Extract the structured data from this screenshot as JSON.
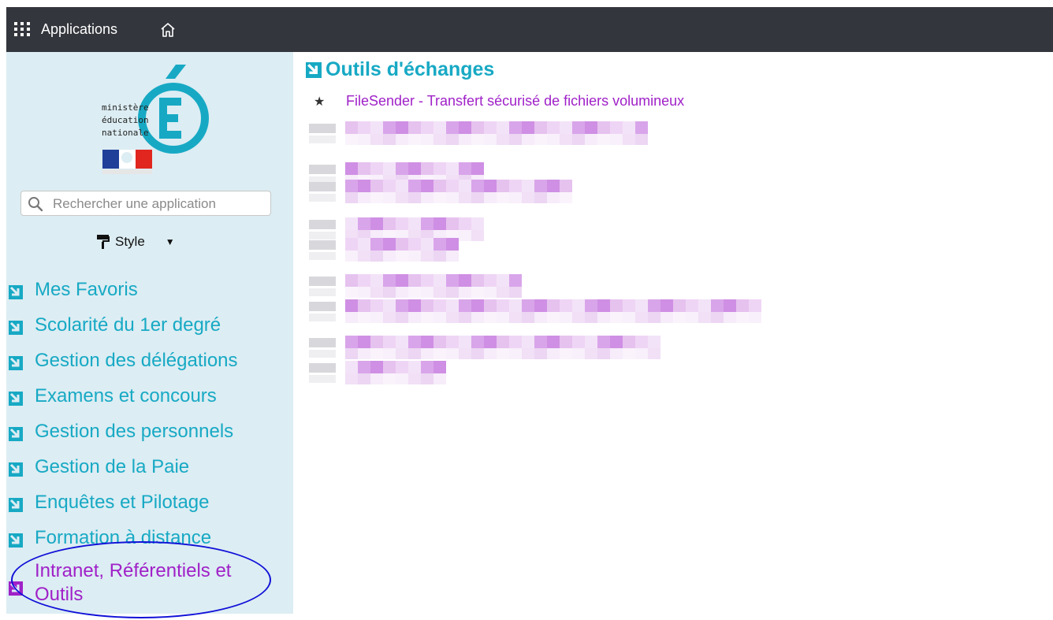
{
  "topbar": {
    "apps_label": "Applications",
    "bg": "#33363c",
    "icons": [
      "grid-icon",
      "home-icon"
    ]
  },
  "sidebar": {
    "logo_lines": [
      "ministère",
      "éducation",
      "nationale"
    ],
    "search": {
      "placeholder": "Rechercher une application",
      "value": ""
    },
    "style_label": "Style",
    "categories": [
      {
        "label": "Mes Favoris"
      },
      {
        "label": "Scolarité du 1er degré"
      },
      {
        "label": "Gestion des délégations"
      },
      {
        "label": "Examens et concours"
      },
      {
        "label": "Gestion des personnels"
      },
      {
        "label": "Gestion de la Paie"
      },
      {
        "label": "Enquêtes et Pilotage"
      },
      {
        "label": "Formation à distance"
      },
      {
        "label": "Intranet, Référentiels et Outils"
      }
    ],
    "active_index": 8
  },
  "main": {
    "section_title": "Outils d'échanges",
    "favorite_app": "FileSender - Transfert sécurisé de fichiers volumineux"
  },
  "colors": {
    "accent_teal": "#17a9c4",
    "accent_purple": "#a021c8",
    "sidebar_bg": "#dcedf3",
    "highlight_circle": "#1010d8"
  }
}
